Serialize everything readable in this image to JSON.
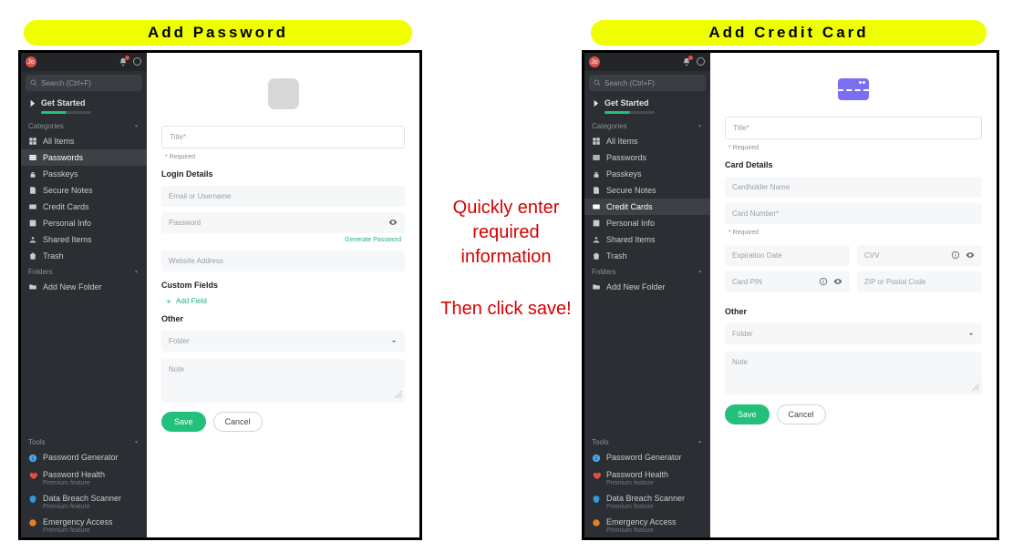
{
  "titles": {
    "left": "Add Password",
    "right": "Add Credit Card"
  },
  "center": {
    "line1": "Quickly enter required information",
    "line2": "Then click save!"
  },
  "sidebar": {
    "avatar": "Jo",
    "search_placeholder": "Search (Ctrl+F)",
    "get_started": "Get Started",
    "headers": {
      "categories": "Categories",
      "folders": "Folders",
      "tools": "Tools"
    },
    "items": {
      "all_items": "All Items",
      "passwords": "Passwords",
      "passkeys": "Passkeys",
      "secure_notes": "Secure Notes",
      "credit_cards": "Credit Cards",
      "personal_info": "Personal Info",
      "shared_items": "Shared Items",
      "trash": "Trash",
      "add_folder": "Add New Folder"
    },
    "tools": {
      "password_generator": "Password Generator",
      "password_health": {
        "label": "Password Health",
        "sub": "Premium feature"
      },
      "data_breach": {
        "label": "Data Breach Scanner",
        "sub": "Premium feature"
      },
      "emergency": {
        "label": "Emergency Access",
        "sub": "Premium feature"
      }
    }
  },
  "password_form": {
    "title_placeholder": "Title*",
    "required": "* Required",
    "login_section": "Login Details",
    "email_placeholder": "Email or Username",
    "password_placeholder": "Password",
    "generate_link": "Generate Password",
    "website_placeholder": "Website Address",
    "custom_fields": "Custom Fields",
    "add_field": "Add Field",
    "other": "Other",
    "folder": "Folder",
    "note": "Note",
    "save": "Save",
    "cancel": "Cancel"
  },
  "card_form": {
    "title_placeholder": "Title*",
    "required": "* Required",
    "card_section": "Card Details",
    "cardholder": "Cardholder Name",
    "card_number": "Card Number*",
    "expiration": "Expiration Date",
    "cvv": "CVV",
    "pin": "Card PIN",
    "zip": "ZIP or Postal Code",
    "other": "Other",
    "folder": "Folder",
    "note": "Note",
    "save": "Save",
    "cancel": "Cancel"
  }
}
